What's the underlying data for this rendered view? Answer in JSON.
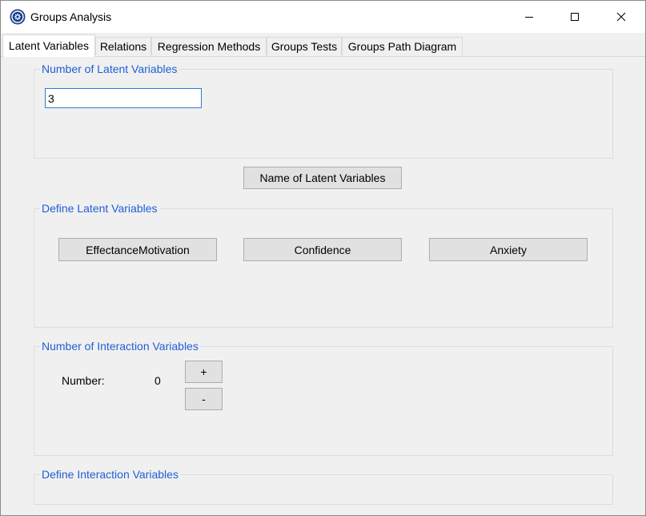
{
  "window": {
    "title": "Groups Analysis"
  },
  "tabs": [
    {
      "label": "Latent Variables",
      "active": true
    },
    {
      "label": "Relations",
      "active": false
    },
    {
      "label": "Regression Methods",
      "active": false
    },
    {
      "label": "Groups Tests",
      "active": false
    },
    {
      "label": "Groups Path Diagram",
      "active": false
    }
  ],
  "latent_count": {
    "group_label": "Number of Latent Variables",
    "value": "3"
  },
  "name_button": "Name of Latent Variables",
  "define_latent": {
    "group_label": "Define Latent Variables",
    "variables": [
      "EffectanceMotivation",
      "Confidence",
      "Anxiety"
    ]
  },
  "interaction": {
    "group_label": "Number of Interaction Variables",
    "number_label": "Number:",
    "number_value": "0",
    "plus_label": "+",
    "minus_label": "-"
  },
  "define_interaction": {
    "group_label": "Define Interaction Variables"
  },
  "colors": {
    "group_label": "#1f5fd6",
    "focus_border": "#2f7bd7",
    "button_face": "#e1e1e1"
  },
  "icons": {
    "app": "app-logo-icon",
    "minimize": "minimize-icon",
    "maximize": "maximize-icon",
    "close": "close-icon"
  }
}
